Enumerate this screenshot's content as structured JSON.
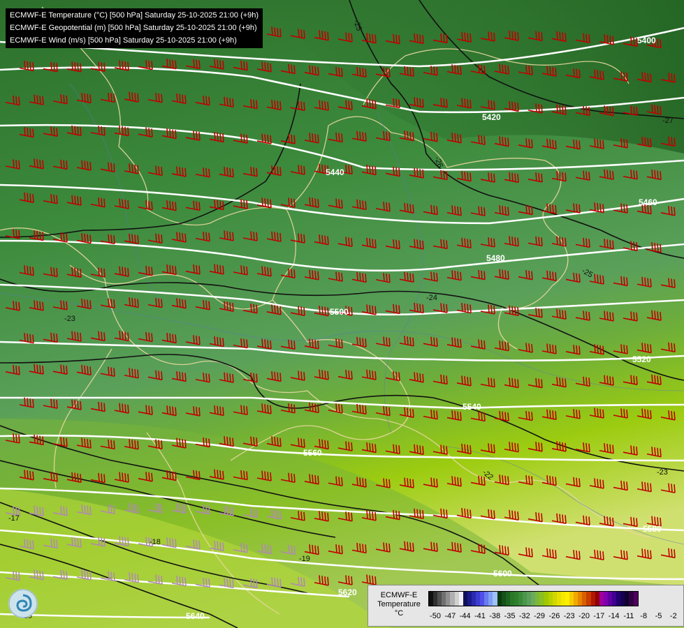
{
  "title_lines": [
    "ECMWF-E Temperature (°C) [500 hPa] Saturday 25-10-2025 21:00 (+9h)",
    "ECMWF-E Geopotential (m) [500 hPa] Saturday 25-10-2025 21:00 (+9h)",
    "ECMWF-E Wind (m/s) [500 hPa] Saturday 25-10-2025 21:00 (+9h)"
  ],
  "legend": {
    "line1": "ECMWF-E",
    "line2": "Temperature",
    "line3": "°C",
    "ticks": [
      "-50",
      "-47",
      "-44",
      "-41",
      "-38",
      "-35",
      "-32",
      "-29",
      "-26",
      "-23",
      "-20",
      "-17",
      "-14",
      "-11",
      "-8",
      "-5",
      "-2"
    ],
    "colors": [
      "#101010",
      "#303030",
      "#505050",
      "#707070",
      "#909090",
      "#b0b0b0",
      "#d0d0d0",
      "#f0f0f0",
      "#10105a",
      "#1a1a8a",
      "#2a2ab0",
      "#3c3cd0",
      "#5050e8",
      "#6a7af0",
      "#7f9ff5",
      "#9fc0f8",
      "#0a3a0a",
      "#14501a",
      "#1e6420",
      "#287828",
      "#2f7f2f",
      "#3a8a3a",
      "#4a964a",
      "#5aa05a",
      "#6aaa5a",
      "#7ab83a",
      "#8cc020",
      "#a0c800",
      "#b8d000",
      "#d0d800",
      "#e6e000",
      "#f5e800",
      "#ffee00",
      "#f6cc00",
      "#f0a800",
      "#e88400",
      "#d86000",
      "#c83c00",
      "#b01800",
      "#900000",
      "#a000a0",
      "#8000b0",
      "#6000a0",
      "#400090",
      "#200070",
      "#180050",
      "#100030",
      "#300040",
      "#500060"
    ]
  },
  "geopotential_labels": [
    "5400",
    "5420",
    "5440",
    "5460",
    "5480",
    "5500",
    "5520",
    "5540",
    "5560",
    "5580",
    "5600",
    "5620",
    "5640"
  ],
  "temperature_labels": [
    "-25",
    "-26",
    "-27",
    "-24",
    "-25",
    "-23",
    "-22",
    "-23",
    "-17",
    "-18",
    "-19",
    "-20"
  ]
}
